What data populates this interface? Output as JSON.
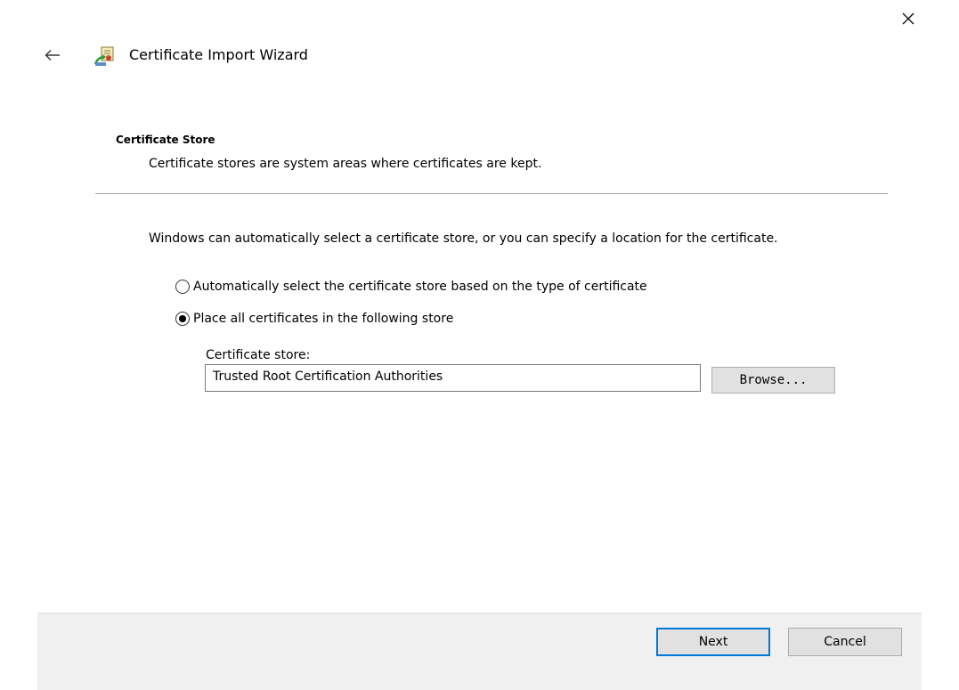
{
  "window": {
    "close_icon": "close-icon"
  },
  "header": {
    "back_icon": "back-arrow-icon",
    "wizard_icon": "certificate-wizard-icon",
    "title": "Certificate Import Wizard"
  },
  "section": {
    "heading": "Certificate Store",
    "description": "Certificate stores are system areas where certificates are kept."
  },
  "body": {
    "intro": "Windows can automatically select a certificate store, or you can specify a location for the certificate.",
    "options": [
      {
        "label": "Automatically select the certificate store based on the type of certificate",
        "selected": false
      },
      {
        "label": "Place all certificates in the following store",
        "selected": true
      }
    ],
    "store_label": "Certificate store:",
    "store_value": "Trusted Root Certification Authorities",
    "browse_label": "Browse..."
  },
  "footer": {
    "next_label": "Next",
    "cancel_label": "Cancel"
  },
  "colors": {
    "accent": "#0078d7",
    "footer_bg": "#f0f0f0",
    "button_bg": "#e1e1e1"
  }
}
